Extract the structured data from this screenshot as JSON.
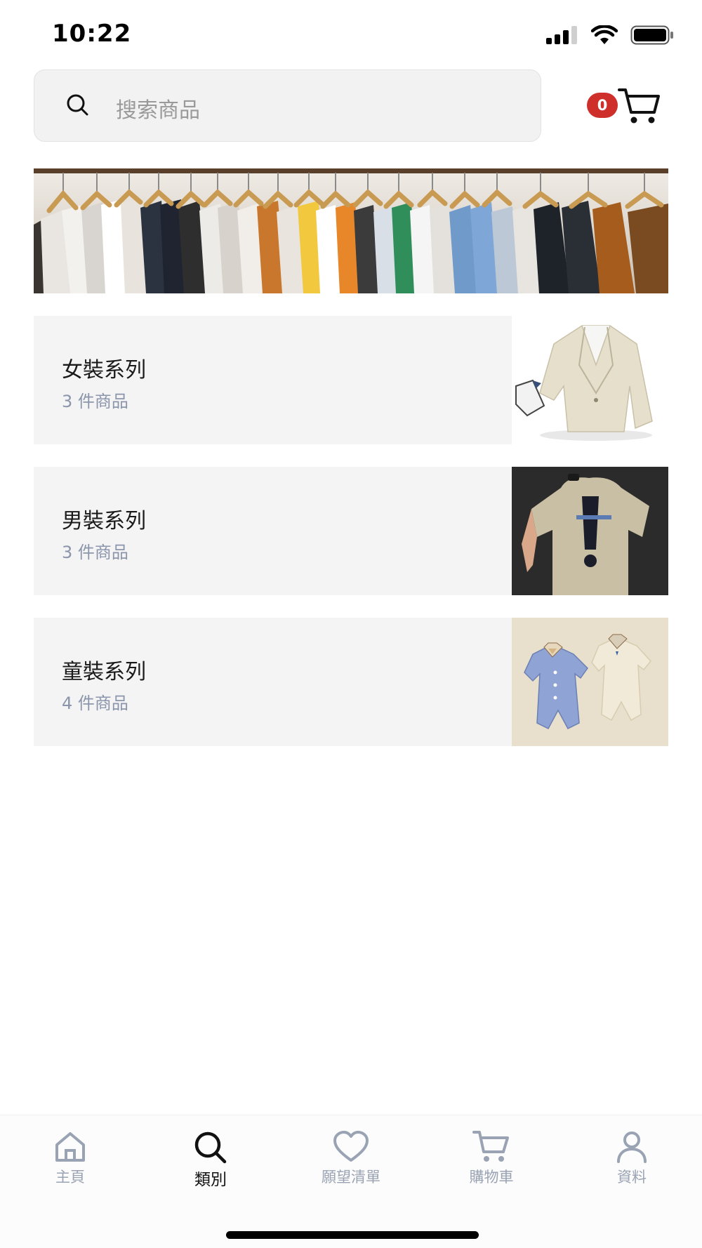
{
  "status_bar": {
    "time": "10:22",
    "icons": [
      "signal-icon",
      "wifi-icon",
      "battery-icon"
    ]
  },
  "header": {
    "search_placeholder": "搜索商品",
    "cart_count": "0"
  },
  "categories": [
    {
      "title": "女裝系列",
      "count": "3 件商品",
      "image": "blazer-photo"
    },
    {
      "title": "男裝系列",
      "count": "3 件商品",
      "image": "tshirt-photo"
    },
    {
      "title": "童裝系列",
      "count": "4 件商品",
      "image": "baby-romper-photo"
    }
  ],
  "bottom_nav": {
    "active": "類別",
    "items": [
      {
        "label": "主頁",
        "icon": "home-icon"
      },
      {
        "label": "類別",
        "icon": "search-icon"
      },
      {
        "label": "願望清單",
        "icon": "heart-icon"
      },
      {
        "label": "購物車",
        "icon": "cart-icon"
      },
      {
        "label": "資料",
        "icon": "user-icon"
      }
    ]
  },
  "colors": {
    "badge": "#cf2f2b",
    "card_bg": "#f4f4f4",
    "count_text": "#8b95ab",
    "nav_inactive": "#9aa3b3"
  }
}
